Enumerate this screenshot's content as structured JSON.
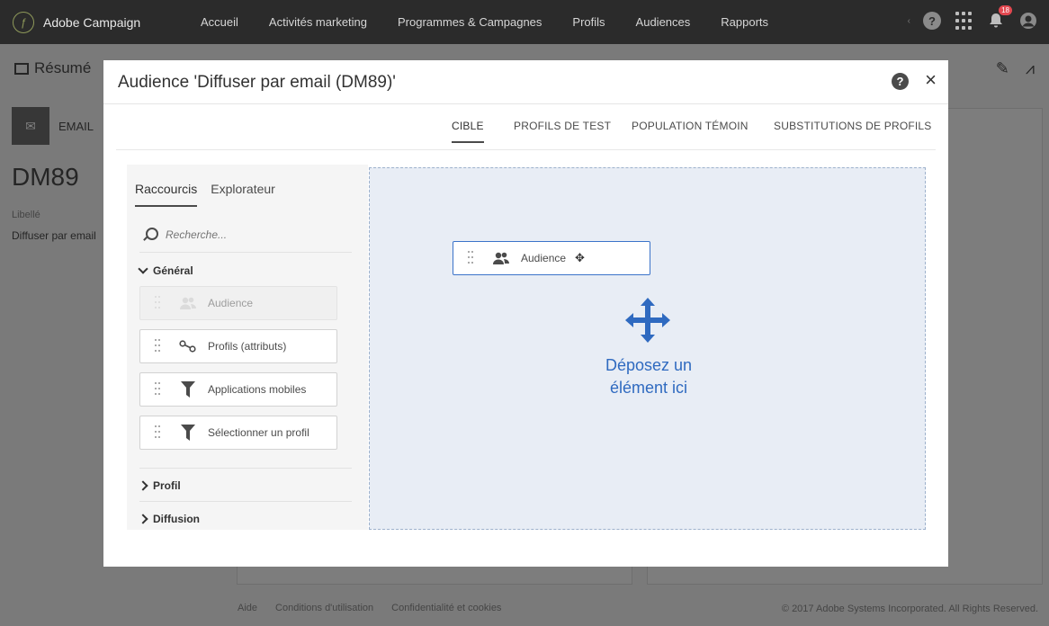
{
  "topbar": {
    "brand": "Adobe Campaign",
    "nav": [
      "Accueil",
      "Activités marketing",
      "Programmes & Campagnes",
      "Profils",
      "Audiences",
      "Rapports"
    ],
    "notification_count": "18",
    "help_glyph": "?"
  },
  "background": {
    "summary_label": "Résumé",
    "channel_label": "EMAIL",
    "title": "DM89",
    "libelle_label": "Libellé",
    "libelle_value": "Diffuser par email",
    "footer_links": [
      "Aide",
      "Conditions d'utilisation",
      "Confidentialité et cookies"
    ],
    "copyright": "© 2017 Adobe Systems Incorporated. All Rights Reserved."
  },
  "modal": {
    "title": "Audience 'Diffuser par email (DM89)'",
    "help_glyph": "?",
    "close_glyph": "×",
    "tabs": [
      "CIBLE",
      "PROFILS DE TEST",
      "POPULATION TÉMOIN",
      "SUBSTITUTIONS DE PROFILS"
    ],
    "active_tab": "CIBLE"
  },
  "palette": {
    "tabs": [
      "Raccourcis",
      "Explorateur"
    ],
    "active_tab": "Raccourcis",
    "search_placeholder": "Recherche...",
    "sections": {
      "general": "Général",
      "profil": "Profil",
      "diffusion": "Diffusion"
    },
    "items": [
      {
        "label": "Audience",
        "icon": "users-icon",
        "disabled": true
      },
      {
        "label": "Profils (attributs)",
        "icon": "relation-icon",
        "disabled": false
      },
      {
        "label": "Applications mobiles",
        "icon": "filter-icon",
        "disabled": false
      },
      {
        "label": "Sélectionner un profil",
        "icon": "filter-icon",
        "disabled": false
      }
    ]
  },
  "dropzone": {
    "dragged_item": "Audience",
    "message": "Déposez un élément ici",
    "accent": "#2f6ac0"
  }
}
